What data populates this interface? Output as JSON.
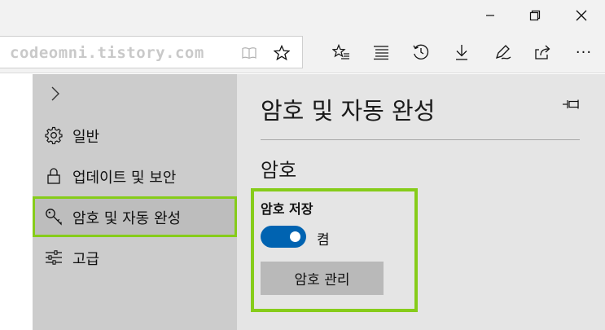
{
  "window": {
    "controls": [
      {
        "name": "minimize-button",
        "icon": "minimize-icon"
      },
      {
        "name": "restore-button",
        "icon": "restore-icon"
      },
      {
        "name": "close-button",
        "icon": "close-icon"
      }
    ]
  },
  "toolbar": {
    "url": "codeomni.tistory.com",
    "reading_view_icon": "book-icon",
    "favorite_icon": "star-icon",
    "icons": [
      "favorites-icon",
      "reading-list-icon",
      "history-icon",
      "download-icon",
      "pen-icon",
      "share-icon",
      "more-icon"
    ],
    "more_label": "···"
  },
  "settings": {
    "nav": {
      "items": [
        {
          "label": "일반",
          "icon": "gear-icon"
        },
        {
          "label": "업데이트 및 보안",
          "icon": "lock-icon"
        },
        {
          "label": "암호 및 자동 완성",
          "icon": "key-icon",
          "active": true
        },
        {
          "label": "고급",
          "icon": "sliders-icon"
        }
      ]
    },
    "content": {
      "title": "암호 및 자동 완성",
      "section_title": "암호",
      "save_password_label": "암호 저장",
      "toggle_state": "켬",
      "toggle_on": true,
      "manage_button": "암호 관리"
    }
  },
  "colors": {
    "highlight": "#86cc1a",
    "toggle_on": "#0063b1"
  }
}
